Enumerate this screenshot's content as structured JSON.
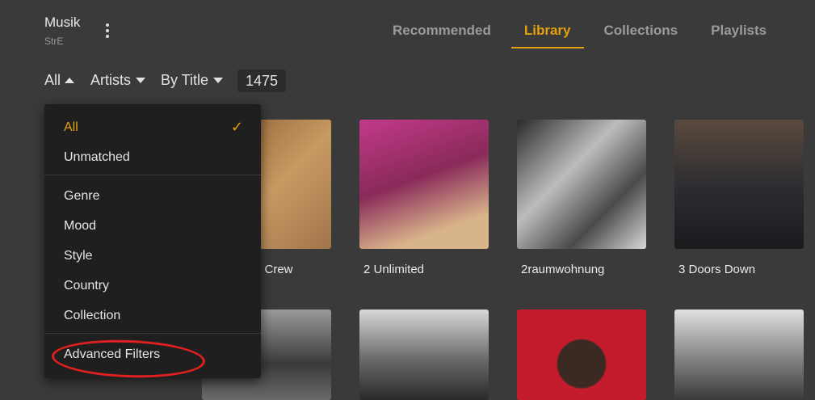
{
  "header": {
    "library_name": "Musik",
    "server_name": "StrE",
    "tabs": [
      {
        "label": "Recommended",
        "active": false
      },
      {
        "label": "Library",
        "active": true
      },
      {
        "label": "Collections",
        "active": false
      },
      {
        "label": "Playlists",
        "active": false
      }
    ]
  },
  "filter_bar": {
    "filter_label": "All",
    "type_label": "Artists",
    "sort_label": "By Title",
    "item_count": "1475"
  },
  "dropdown": {
    "items": [
      {
        "label": "All",
        "selected": true
      },
      {
        "label": "Unmatched",
        "selected": false
      },
      {
        "label": "Genre"
      },
      {
        "label": "Mood"
      },
      {
        "label": "Style"
      },
      {
        "label": "Country"
      },
      {
        "label": "Collection"
      },
      {
        "label": "Advanced Filters"
      }
    ],
    "check_glyph": "✓"
  },
  "grid": {
    "row1": [
      "e Crew",
      "2 Unlimited",
      "2raumwohnung",
      "3 Doors Down"
    ]
  },
  "colors": {
    "accent": "#e5a00d",
    "background": "#3a3a3a",
    "menu_background": "#1f1f1f",
    "annotation": "#e02020"
  }
}
